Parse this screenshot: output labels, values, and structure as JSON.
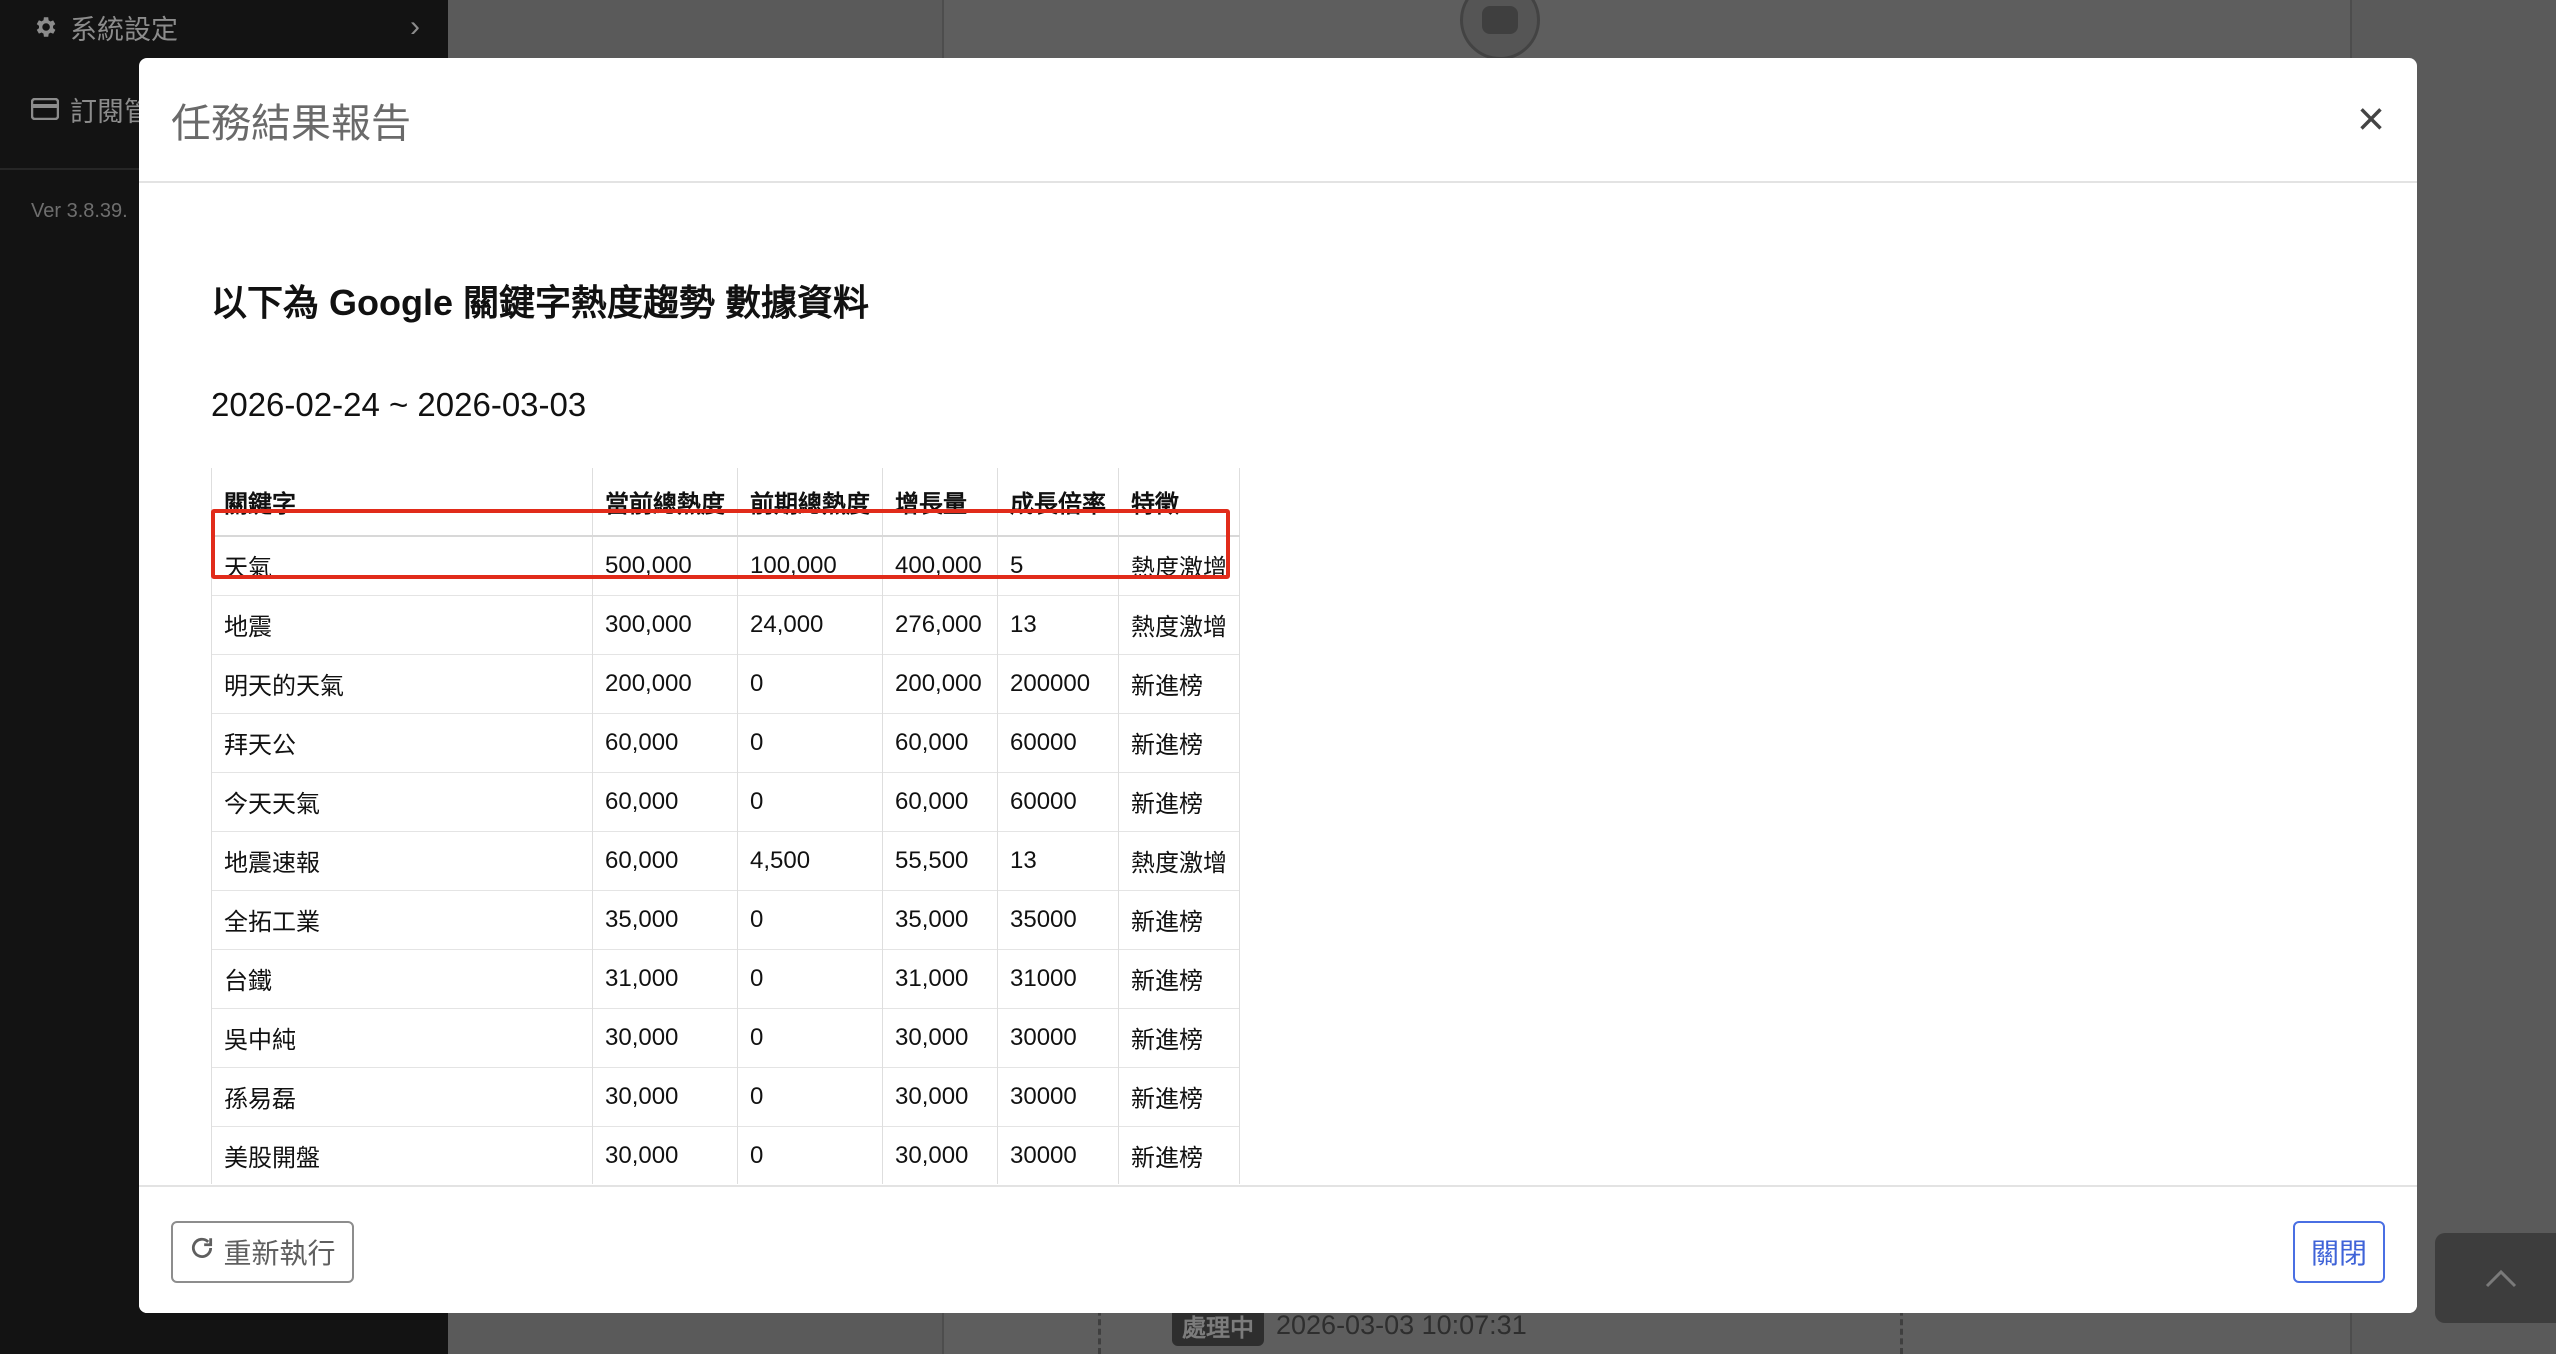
{
  "sidebar": {
    "settings_label": "系統設定",
    "subscription_label": "訂閱管",
    "version": "Ver 3.8.39."
  },
  "background": {
    "status_badge": "處理中",
    "status_time": "2026-03-03 10:07:31"
  },
  "modal": {
    "title": "任務結果報告",
    "close_icon": "×",
    "heading": "以下為 Google 關鍵字熱度趨勢 數據資料",
    "date_range": "2026-02-24 ~ 2026-03-03",
    "table": {
      "headers": [
        "關鍵字",
        "當前總熱度",
        "前期總熱度",
        "增長量",
        "成長倍率",
        "特徵"
      ],
      "rows": [
        [
          "天氣",
          "500,000",
          "100,000",
          "400,000",
          "5",
          "熱度激增"
        ],
        [
          "地震",
          "300,000",
          "24,000",
          "276,000",
          "13",
          "熱度激增"
        ],
        [
          "明天的天氣",
          "200,000",
          "0",
          "200,000",
          "200000",
          "新進榜"
        ],
        [
          "拜天公",
          "60,000",
          "0",
          "60,000",
          "60000",
          "新進榜"
        ],
        [
          "今天天氣",
          "60,000",
          "0",
          "60,000",
          "60000",
          "新進榜"
        ],
        [
          "地震速報",
          "60,000",
          "4,500",
          "55,500",
          "13",
          "熱度激增"
        ],
        [
          "全拓工業",
          "35,000",
          "0",
          "35,000",
          "35000",
          "新進榜"
        ],
        [
          "台鐵",
          "31,000",
          "0",
          "31,000",
          "31000",
          "新進榜"
        ],
        [
          "吳中純",
          "30,000",
          "0",
          "30,000",
          "30000",
          "新進榜"
        ],
        [
          "孫易磊",
          "30,000",
          "0",
          "30,000",
          "30000",
          "新進榜"
        ],
        [
          "美股開盤",
          "30,000",
          "0",
          "30,000",
          "30000",
          "新進榜"
        ],
        [
          "",
          "",
          "",
          "",
          "",
          ""
        ]
      ]
    },
    "footer": {
      "rerun_label": "重新執行",
      "close_label": "關閉"
    }
  },
  "icons": {
    "settings": "gear-icon",
    "subscription": "credit-card-icon",
    "rerun": "refresh-icon",
    "to_top": "chevron-up-icon"
  },
  "colors": {
    "highlight": "#e12b1a",
    "primary": "#3f63d8"
  }
}
